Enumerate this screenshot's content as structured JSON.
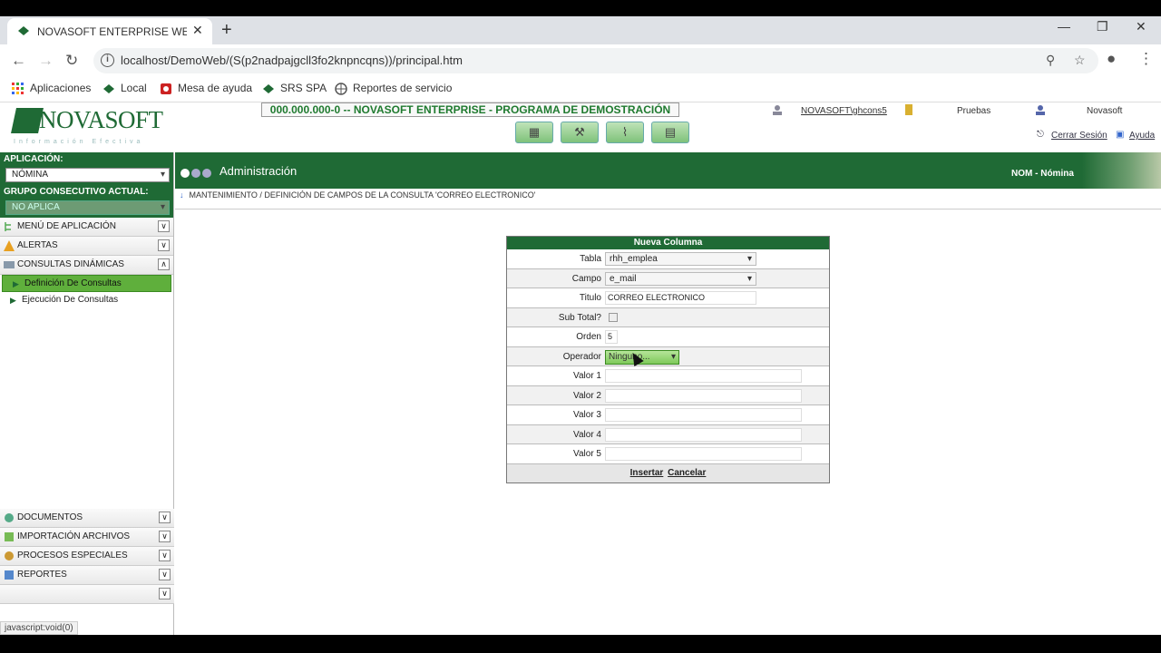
{
  "browser": {
    "tab_title": "NOVASOFT ENTERPRISE WEB - S",
    "url": "localhost/DemoWeb/(S(p2nadpajgcll3fo2knpncqns))/principal.htm",
    "bookmarks": [
      "Aplicaciones",
      "Local",
      "Mesa de ayuda",
      "SRS SPA",
      "Reportes de servicio"
    ]
  },
  "header": {
    "logo": "NOVASOFT",
    "logo_tagline": "Información Efectiva",
    "banner": "000.000.000-0 -- NOVASOFT ENTERPRISE - PROGRAMA DE DEMOSTRACIÓN",
    "user": "NOVASOFT\\ghcons5",
    "database": "Pruebas",
    "company": "Novasoft",
    "logout": "Cerrar Sesión",
    "help": "Ayuda"
  },
  "sidebar": {
    "app_label": "APLICACIÓN:",
    "app_value": "NÓMINA",
    "group_label": "GRUPO CONSECUTIVO ACTUAL:",
    "group_value": "NO APLICA",
    "items": [
      {
        "label": "MENÚ DE APLICACIÓN",
        "icon": "tree-icon"
      },
      {
        "label": "ALERTAS",
        "icon": "alert-icon"
      },
      {
        "label": "CONSULTAS DINÁMICAS",
        "icon": "query-icon"
      }
    ],
    "sub_items": [
      "Definición De Consultas",
      "Ejecución De Consultas"
    ],
    "bottom_items": [
      {
        "label": "DOCUMENTOS",
        "icon": "documents-icon"
      },
      {
        "label": "IMPORTACIÓN ARCHIVOS",
        "icon": "import-icon"
      },
      {
        "label": "PROCESOS ESPECIALES",
        "icon": "gears-icon"
      },
      {
        "label": "REPORTES",
        "icon": "reports-icon"
      },
      {
        "label": "",
        "icon": "more-icon"
      }
    ]
  },
  "content": {
    "title": "Administración",
    "module": "NOM - Nómina",
    "breadcrumb": "MANTENIMIENTO / DEFINICIÓN DE CAMPOS DE LA CONSULTA 'CORREO ELECTRONICO'"
  },
  "form": {
    "title": "Nueva Columna",
    "tabla_label": "Tabla",
    "tabla_value": "rhh_emplea",
    "campo_label": "Campo",
    "campo_value": "e_mail",
    "titulo_label": "Titulo",
    "titulo_value": "CORREO ELECTRONICO",
    "subtotal_label": "Sub Total?",
    "orden_label": "Orden",
    "orden_value": "5",
    "operador_label": "Operador",
    "operador_value": "Ninguno...",
    "valor_labels": [
      "Valor 1",
      "Valor 2",
      "Valor 3",
      "Valor 4",
      "Valor 5"
    ],
    "insert_label": "Insertar",
    "cancel_label": "Cancelar"
  },
  "status": "javascript:void(0)"
}
